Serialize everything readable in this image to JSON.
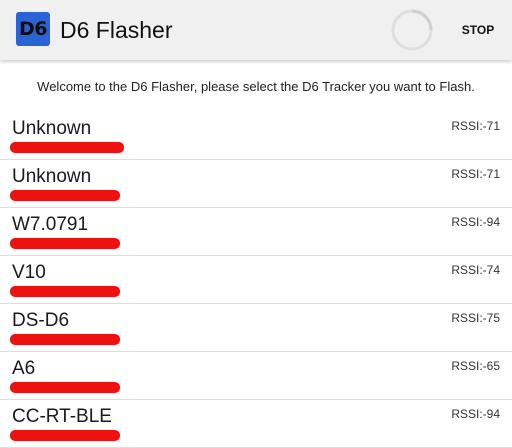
{
  "app": {
    "icon_text": "D6",
    "title": "D6 Flasher",
    "stop_label": "STOP"
  },
  "welcome_text": "Welcome to the D6 Flasher, please select the D6 Tracker you want to Flash.",
  "devices": [
    {
      "name": "Unknown",
      "rssi": "RSSI:-71"
    },
    {
      "name": "Unknown",
      "rssi": "RSSI:-71"
    },
    {
      "name": "W7.0791",
      "rssi": "RSSI:-94"
    },
    {
      "name": "V10",
      "rssi": "RSSI:-74"
    },
    {
      "name": "DS-D6",
      "rssi": "RSSI:-75"
    },
    {
      "name": "A6",
      "rssi": "RSSI:-65"
    },
    {
      "name": "CC-RT-BLE",
      "rssi": "RSSI:-94"
    }
  ],
  "colors": {
    "appbar_bg": "#f0f0f0",
    "icon_bg": "#2a63d6",
    "redaction": "#ee1111"
  }
}
